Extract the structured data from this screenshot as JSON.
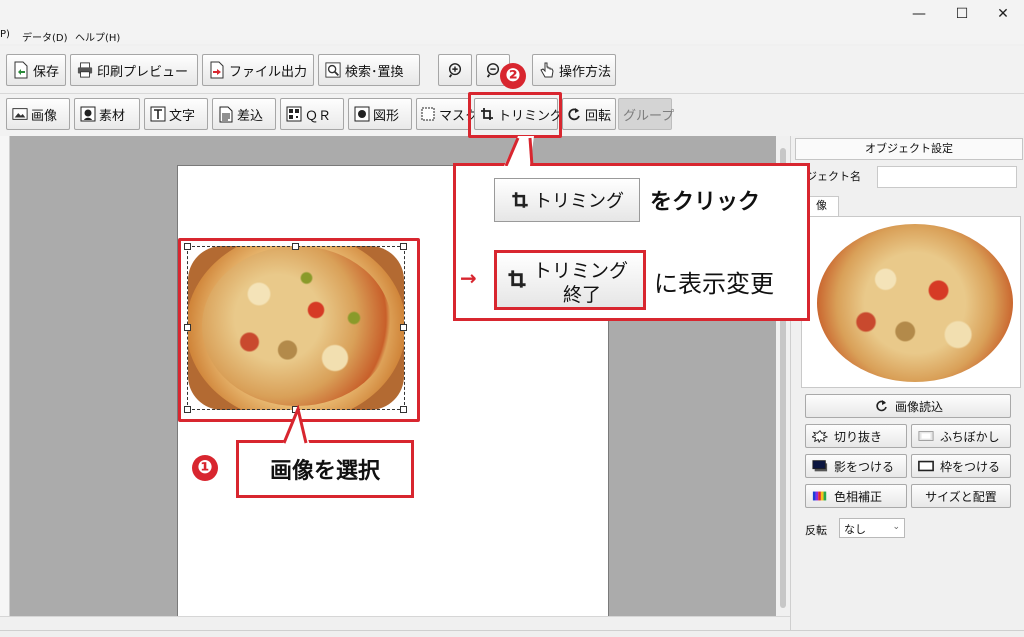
{
  "window": {
    "controls": {
      "minimize": "—",
      "maximize": "☐",
      "close": "✕"
    }
  },
  "menu": {
    "items": [
      "P)",
      "データ(D)",
      "ヘルプ(H)"
    ]
  },
  "toolbar1": {
    "save": "保存",
    "print_preview": "印刷プレビュー",
    "file_export": "ファイル出力",
    "search_replace": "検索･置換",
    "howto": "操作方法"
  },
  "toolbar2": {
    "image": "画像",
    "material": "素材",
    "text": "文字",
    "merge": "差込",
    "qr": "ＱＲ",
    "shape": "図形",
    "mask": "マスク",
    "trimming": "トリミング",
    "rotate": "回転",
    "group": "グループ"
  },
  "panel": {
    "header": "オブジェクト設定",
    "object_name_label": "ブジェクト名",
    "object_name_value": "",
    "tab_image": "像",
    "load_image": "画像読込",
    "cutout": "切り抜き",
    "blur_border": "ふちぼかし",
    "shadow": "影をつける",
    "frame": "枠をつける",
    "color_correction": "色相補正",
    "size_position": "サイズと配置",
    "rotation_label": "反転",
    "rotation_value": "なし"
  },
  "annotations": {
    "step1_number": "❶",
    "step1_text": "画像を選択",
    "step2_number": "❷",
    "button_trim": "トリミング",
    "click_text": "をクリック",
    "button_trim_end_line1": "トリミング",
    "button_trim_end_line2": "終了",
    "change_text": "に表示変更",
    "accent_color": "#d8262f"
  }
}
